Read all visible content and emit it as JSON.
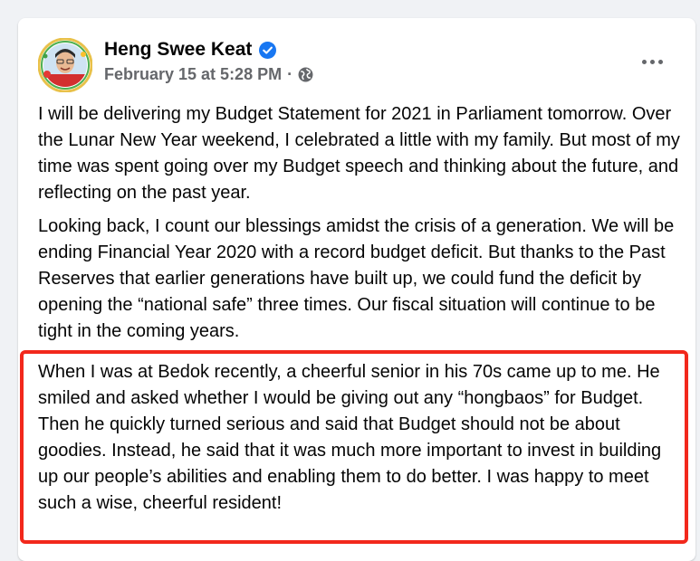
{
  "post": {
    "author": "Heng Swee Keat",
    "timestamp": "February 15 at 5:28 PM",
    "separator": "·",
    "privacy_icon": "globe-icon",
    "verified_icon": "verified-badge-icon",
    "more_icon": "more-options-icon",
    "paragraphs": [
      "I will be delivering my Budget Statement for 2021 in Parliament tomorrow. Over the Lunar New Year weekend, I celebrated a little with my family. But most of my time was spent going over my Budget speech and thinking about the future, and reflecting on the past year.",
      "Looking back, I count our blessings amidst the crisis of a generation. We will be ending Financial Year 2020 with a record budget deficit. But thanks to the Past Reserves that earlier generations have built up, we could fund the deficit by opening the “national safe” three times. Our fiscal situation will continue to be tight in the coming years.",
      "When I was at Bedok recently, a cheerful senior in his 70s came up to me. He smiled and asked whether I would be giving out any “hongbaos” for Budget. Then he quickly turned serious and said that Budget should not be about goodies. Instead, he said that it was much more important to invest in building up our people’s abilities and enabling them to do better. I was happy to meet such a wise, cheerful resident!"
    ]
  },
  "colors": {
    "highlight_border": "#f2281c",
    "verified_blue": "#1877f2",
    "meta_gray": "#65676b"
  }
}
